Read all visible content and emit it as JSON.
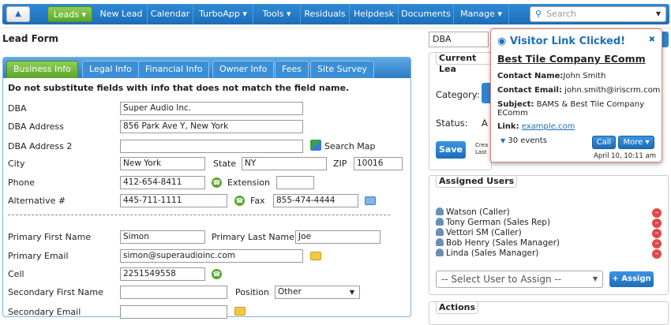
{
  "nav": {
    "home_icon": "home-icon",
    "items": [
      {
        "label": "Leads ▾",
        "active": true
      },
      {
        "label": "New Lead"
      },
      {
        "label": "Calendar"
      },
      {
        "label": "TurboApp ▾"
      },
      {
        "label": "Tools ▾"
      },
      {
        "label": "Residuals"
      },
      {
        "label": "Helpdesk"
      },
      {
        "label": "Documents"
      },
      {
        "label": "Manage ▾"
      }
    ],
    "search_placeholder": "Search"
  },
  "page": {
    "title": "Lead Form"
  },
  "tabs": [
    "Business Info",
    "Legal Info",
    "Financial Info",
    "Owner Info",
    "Fees",
    "Site Survey"
  ],
  "form": {
    "warning": "Do not substitute fields with info that does not match the field name.",
    "dba_label": "DBA",
    "dba_value": "Super Audio Inc.",
    "dba_address_label": "DBA Address",
    "dba_address_value": "856 Park Ave Y, New York",
    "dba_address2_label": "DBA Address 2",
    "dba_address2_value": "",
    "search_map": "Search Map",
    "city_label": "City",
    "city_value": "New York",
    "state_label": "State",
    "state_value": "NY",
    "zip_label": "ZIP",
    "zip_value": "10016",
    "phone_label": "Phone",
    "phone_value": "412-654-8411",
    "extension_label": "Extension",
    "extension_value": "",
    "alt_label": "Alternative #",
    "alt_value": "445-711-1111",
    "fax_label": "Fax",
    "fax_value": "855-474-4444",
    "pfirst_label": "Primary First Name",
    "pfirst_value": "Simon",
    "plast_label": "Primary Last Name",
    "plast_value": "Joe",
    "pemail_label": "Primary Email",
    "pemail_value": "simon@superaudioinc.com",
    "cell_label": "Cell",
    "cell_value": "2251549558",
    "sfirst_label": "Secondary First Name",
    "sfirst_value": "",
    "position_label": "Position",
    "position_value": "Other",
    "semail_label": "Secondary Email",
    "semail_value": ""
  },
  "right": {
    "dba_select": "DBA",
    "current_lead_title": "Current Lea",
    "category_label": "Category:",
    "status_label": "Status:",
    "status_value": "A",
    "save_label": "Save",
    "created_text": "Crea",
    "last_text": "Last"
  },
  "assigned": {
    "title": "Assigned Users",
    "users": [
      "Watson (Caller)",
      "Tony German (Sales Rep)",
      "Vettori SM (Caller)",
      "Bob Henry (Sales Manager)",
      "Linda (Sales Manager)"
    ],
    "select_placeholder": "-- Select User to Assign --",
    "assign_label": "+ Assign"
  },
  "actions": {
    "title": "Actions"
  },
  "popup": {
    "title": "Visitor Link Clicked!",
    "company": "Best Tile Company EComm",
    "contact_name_label": "Contact Name:",
    "contact_name": "John Smith",
    "contact_email_label": "Contact Email:",
    "contact_email": "john.smith@iriscrm.com",
    "subject_label": "Subject:",
    "subject": "BAMS & Best Tile Company EComm",
    "link_label": "Link:",
    "link": "example.com",
    "events": "30 events",
    "call_label": "Call",
    "more_label": "More ▾",
    "date": "April 10, 10:11 am"
  },
  "colors": {
    "nav": "#1c6db8",
    "accent_green": "#5aa62b",
    "delete_red": "#e04848"
  }
}
